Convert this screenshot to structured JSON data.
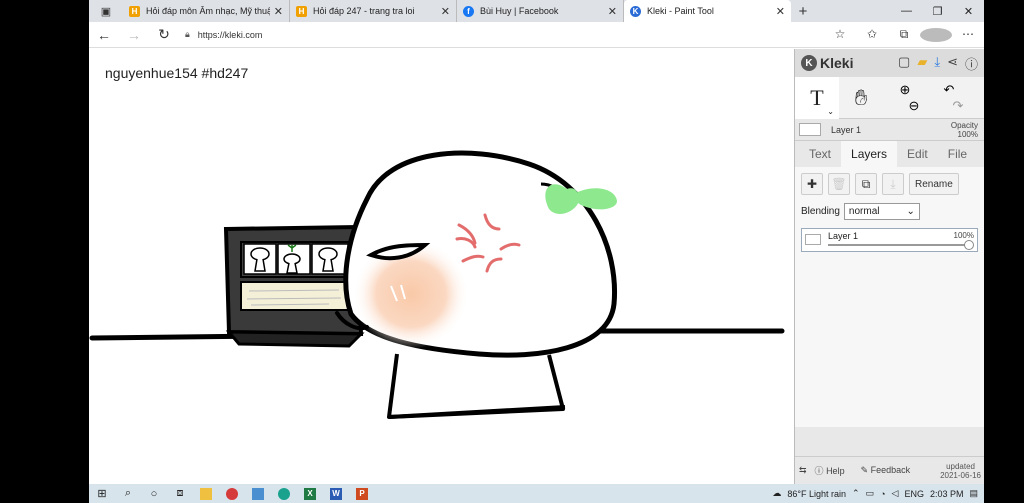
{
  "browser": {
    "tabs": [
      {
        "title": "Hỏi đáp môn Âm nhạc, Mỹ thuật,",
        "favicon": "H",
        "favicon_color": "#f0a000"
      },
      {
        "title": "Hỏi đáp 247 - trang tra loi",
        "favicon": "H",
        "favicon_color": "#f0a000"
      },
      {
        "title": "Bùi Huy | Facebook",
        "favicon": "f",
        "favicon_color": "#1877f2"
      },
      {
        "title": "Kleki - Paint Tool",
        "favicon": "K",
        "favicon_color": "#2b6bd6",
        "active": true
      }
    ],
    "new_tab": "+",
    "url": "https://kleki.com"
  },
  "canvas": {
    "caption": "nguyenhue154 #hd247"
  },
  "panel": {
    "logo": "Kleki",
    "layer_name": "Layer 1",
    "opacity_label": "Opacity",
    "opacity_value": "100%",
    "tabs": [
      "Text",
      "Layers",
      "Edit",
      "File"
    ],
    "active_tab": "Layers",
    "rename_label": "Rename",
    "blending_label": "Blending",
    "blending_value": "normal",
    "layer_item": {
      "name": "Layer 1",
      "opacity": "100%"
    },
    "footer": {
      "help": "Help",
      "feedback": "Feedback",
      "updated_label": "updated",
      "updated_date": "2021-06-16"
    }
  },
  "taskbar": {
    "weather": "86°F  Light rain",
    "lang": "ENG",
    "time": "2:03 PM"
  },
  "colors": {
    "sprout": "#8ee88e",
    "blush": "#f9c9a8",
    "anger": "#e36d6d",
    "screen": "#3a3a3a"
  }
}
